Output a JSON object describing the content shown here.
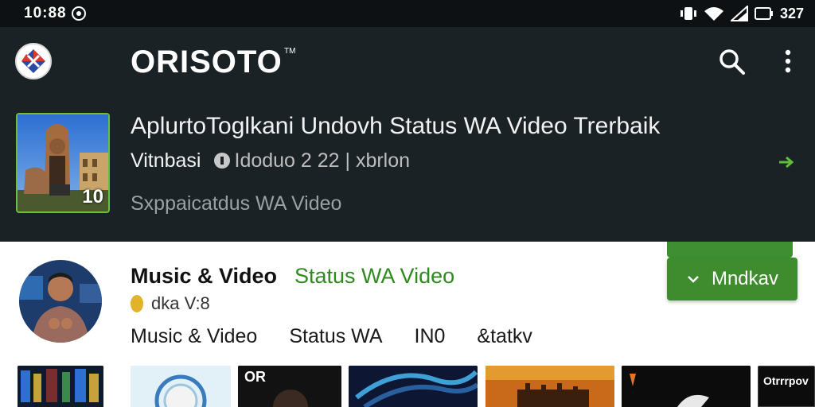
{
  "status_bar": {
    "time": "10:88",
    "battery": "327"
  },
  "app_bar": {
    "title": "ORISOTO",
    "tm": "TM"
  },
  "featured": {
    "title": "AplurtoToglkani Undovh Status WA Video  Trerbaik",
    "meta_label": "Vitnbasi",
    "meta_value": "Idoduo 2 22 | xbrlon",
    "subtitle": "Sxppaicatdus WA Video",
    "thumb_number": "10"
  },
  "channel": {
    "name": "Music & Video",
    "tag": "Status WA Video",
    "sub_text": "dka V:8",
    "subscribe_label": "Mndkav",
    "tabs": [
      "Music & Video",
      "Status WA",
      "IN0",
      "&tatkv"
    ]
  },
  "grid": [
    {
      "label": ""
    },
    {
      "label": ""
    },
    {
      "label": "OR"
    },
    {
      "label": ""
    },
    {
      "label": ""
    },
    {
      "label": ""
    },
    {
      "label": "Otrrrpov"
    }
  ],
  "colors": {
    "accent_green": "#3e8c2d",
    "tag_green": "#2f8a1f",
    "dark_bg": "#1b2226",
    "status_bg": "#0d1114"
  }
}
